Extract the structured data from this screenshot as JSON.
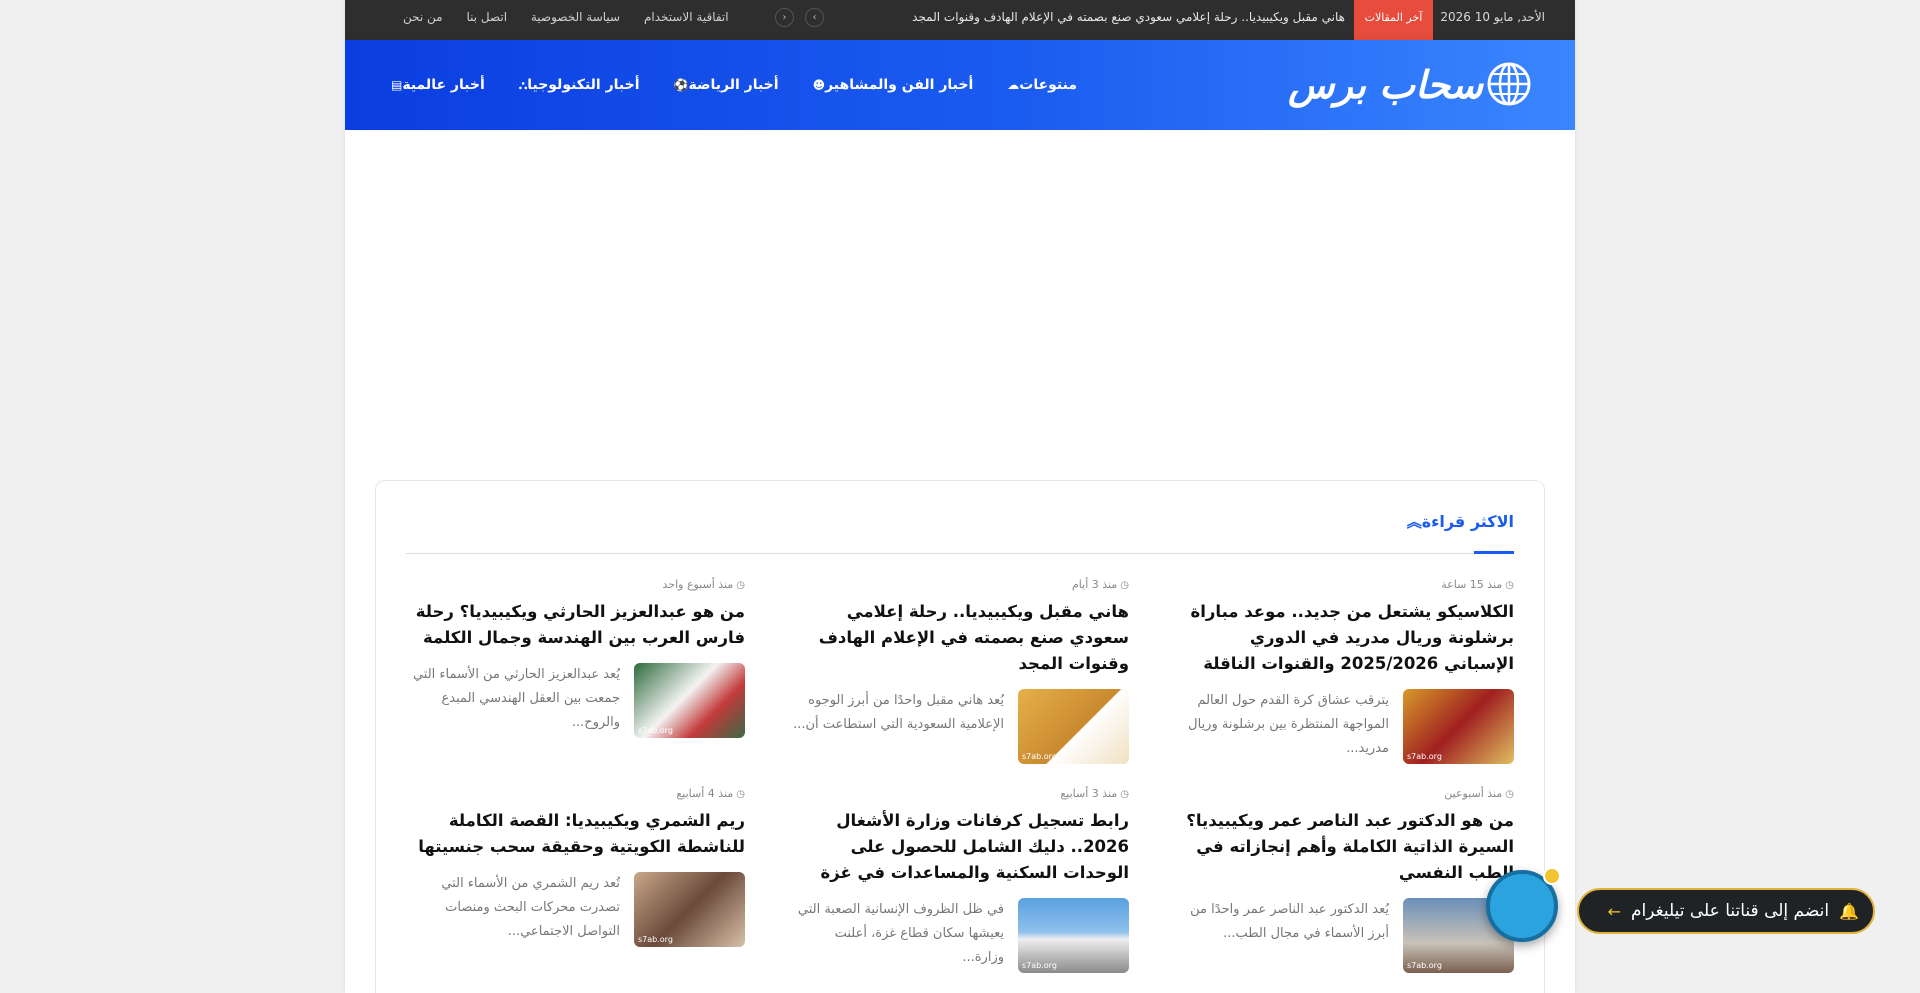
{
  "topbar": {
    "date": "الأحد, مايو 10 2026",
    "badge": "آخر المقالات",
    "ticker": "هاني مقبل ويكيبيديا.. رحلة إعلامي سعودي صنع بصمته في الإعلام الهادف وقنوات المجد",
    "arrow_prev": "‹",
    "arrow_next": "›",
    "links": [
      "اتفاقية الاستخدام",
      "سياسة الخصوصية",
      "اتصل بنا",
      "من نحن"
    ]
  },
  "header": {
    "logo_text": "سحاب برس",
    "nav": [
      {
        "label": "أخبار عالمية",
        "icon": "newspaper-icon",
        "glyph": "▤"
      },
      {
        "label": "أخبار التكنولوجيا",
        "icon": "sitemap-icon",
        "glyph": "⛬"
      },
      {
        "label": "أخبار الرياضة",
        "icon": "football-icon",
        "glyph": "⚽"
      },
      {
        "label": "أخبار الفن والمشاهير",
        "icon": "smile-icon",
        "glyph": "☻"
      },
      {
        "label": "منتوعات",
        "icon": "cloud-icon",
        "glyph": "☁"
      }
    ]
  },
  "most_read": {
    "title": "الاكثر قراءة",
    "posts": [
      {
        "time": "منذ 15 ساعة",
        "title": "الكلاسيكو يشتعل من جديد.. موعد مباراة برشلونة وريال مدريد في الدوري الإسباني 2025/2026 والقنوات الناقلة",
        "excerpt": "يترقب عشاق كرة القدم حول العالم المواجهة المنتظرة بين برشلونة وريال مدريد...",
        "watermark": "s7ab.org"
      },
      {
        "time": "منذ 3 أيام",
        "title": "هاني مقبل ويكيبيديا.. رحلة إعلامي سعودي صنع بصمته في الإعلام الهادف وقنوات المجد",
        "excerpt": "يُعد هاني مقبل واحدًا من أبرز الوجوه الإعلامية السعودية التي استطاعت أن...",
        "watermark": "s7ab.org"
      },
      {
        "time": "منذ أسبوع واحد",
        "title": "من هو عبدالعزيز الحارثي ويكيبيديا؟ رحلة فارس العرب بين الهندسة وجمال الكلمة",
        "excerpt": "يُعد عبدالعزيز الحارثي من الأسماء التي جمعت بين العقل الهندسي المبدع والروح...",
        "watermark": "s7ab.org"
      },
      {
        "time": "منذ أسبوعين",
        "title": "من هو الدكتور عبد الناصر عمر ويكيبيديا؟ السيرة الذاتية الكاملة وأهم إنجازاته في الطب النفسي",
        "excerpt": "يُعد الدكتور عبد الناصر عمر واحدًا من أبرز الأسماء في مجال الطب...",
        "watermark": "s7ab.org"
      },
      {
        "time": "منذ 3 أسابيع",
        "title": "رابط تسجيل كرفانات وزارة الأشغال 2026.. دليك الشامل للحصول على الوحدات السكنية والمساعدات في غزة",
        "excerpt": "في ظل الظروف الإنسانية الصعبة التي يعيشها سكان قطاع غزة، أعلنت وزارة...",
        "watermark": "s7ab.org"
      },
      {
        "time": "منذ 4 أسابيع",
        "title": "ريم الشمري ويكيبيديا: القصة الكاملة للناشطة الكويتية وحقيقة سحب جنسيتها",
        "excerpt": "تُعد ريم الشمري من الأسماء التي تصدرت محركات البحث ومنصات التواصل الاجتماعي...",
        "watermark": "s7ab.org"
      }
    ]
  },
  "telegram": {
    "label": "انضم إلى قناتنا على تيليغرام",
    "arrow": "←",
    "bell": "🔔"
  },
  "colors": {
    "accent": "#1b5cf0",
    "badge": "#e74c3c",
    "topbar": "#2e2e2e",
    "telegram": "#2aa3df"
  }
}
